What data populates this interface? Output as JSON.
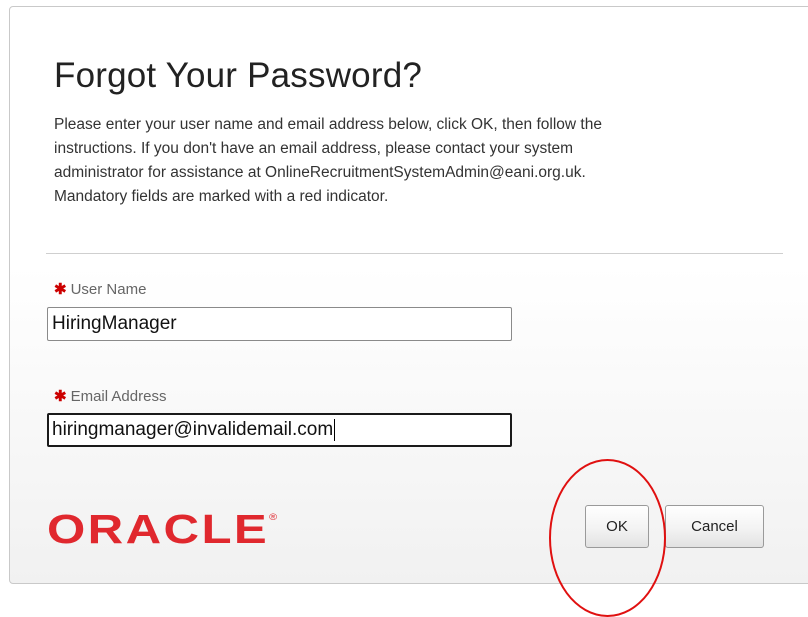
{
  "dialog": {
    "title": "Forgot Your Password?",
    "instructions": [
      "Please enter your user name and email address below, click OK, then follow the",
      "instructions. If you don't have an email address, please contact your system",
      "administrator for assistance at OnlineRecruitmentSystemAdmin@eani.org.uk.",
      "Mandatory fields are marked with a red indicator."
    ]
  },
  "fields": {
    "required_marker": "✱",
    "user_name": {
      "label": "User Name",
      "value": "HiringManager"
    },
    "email": {
      "label": "Email Address",
      "value": "hiringmanager@invalidemail.com"
    }
  },
  "footer": {
    "logo": "ORACLE",
    "logo_mark": "®",
    "ok_label": "OK",
    "cancel_label": "Cancel"
  },
  "colors": {
    "brand_red": "#e0282e",
    "required_red": "#cc0000",
    "annotation_red": "#e01010"
  }
}
